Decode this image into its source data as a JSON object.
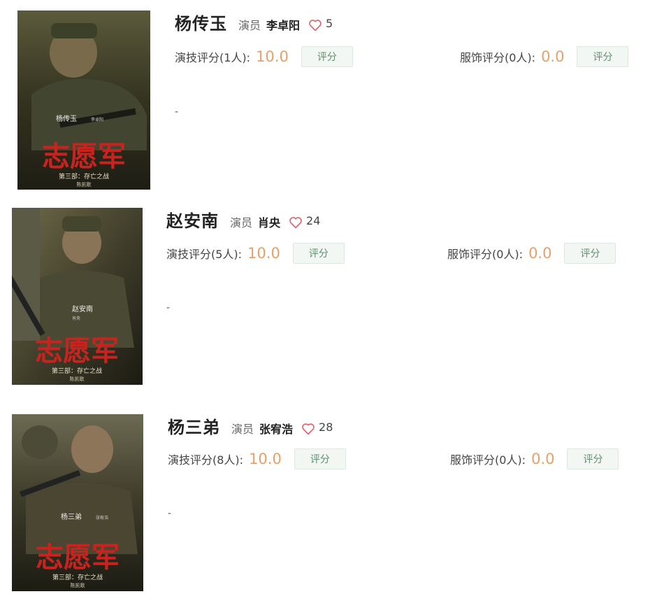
{
  "cards": [
    {
      "role": "杨传玉",
      "role_tag": "演员",
      "actor": "李卓阳",
      "likes": "5",
      "acting_label": "演技评分(1人):",
      "acting_score": "10.0",
      "costume_label": "服饰评分(0人):",
      "costume_score": "0.0",
      "rate_button": "评分",
      "description": "-",
      "poster": {
        "character_caption": "杨传玉",
        "actor_caption": "李卓阳",
        "film_title": "志愿军",
        "subtitle": "第三部：存亡之战",
        "director": "陈凯歌"
      }
    },
    {
      "role": "赵安南",
      "role_tag": "演员",
      "actor": "肖央",
      "likes": "24",
      "acting_label": "演技评分(5人):",
      "acting_score": "10.0",
      "costume_label": "服饰评分(0人):",
      "costume_score": "0.0",
      "rate_button": "评分",
      "description": "-",
      "poster": {
        "character_caption": "赵安南",
        "actor_caption": "肖央",
        "film_title": "志愿军",
        "subtitle": "第三部：存亡之战",
        "director": "陈凯歌"
      }
    },
    {
      "role": "杨三弟",
      "role_tag": "演员",
      "actor": "张宥浩",
      "likes": "28",
      "acting_label": "演技评分(8人):",
      "acting_score": "10.0",
      "costume_label": "服饰评分(0人):",
      "costume_score": "0.0",
      "rate_button": "评分",
      "description": "-",
      "poster": {
        "character_caption": "杨三弟",
        "actor_caption": "张宥浩",
        "film_title": "志愿军",
        "subtitle": "第三部：存亡之战",
        "director": "陈凯歌"
      }
    }
  ],
  "icons": {
    "like": "heart-outline-icon"
  },
  "colors": {
    "score": "#e8a06a",
    "heart": "#e0626a",
    "button_bg": "#f2f7f3",
    "button_text": "#5f8f6d",
    "poster_title": "#c8231f"
  }
}
